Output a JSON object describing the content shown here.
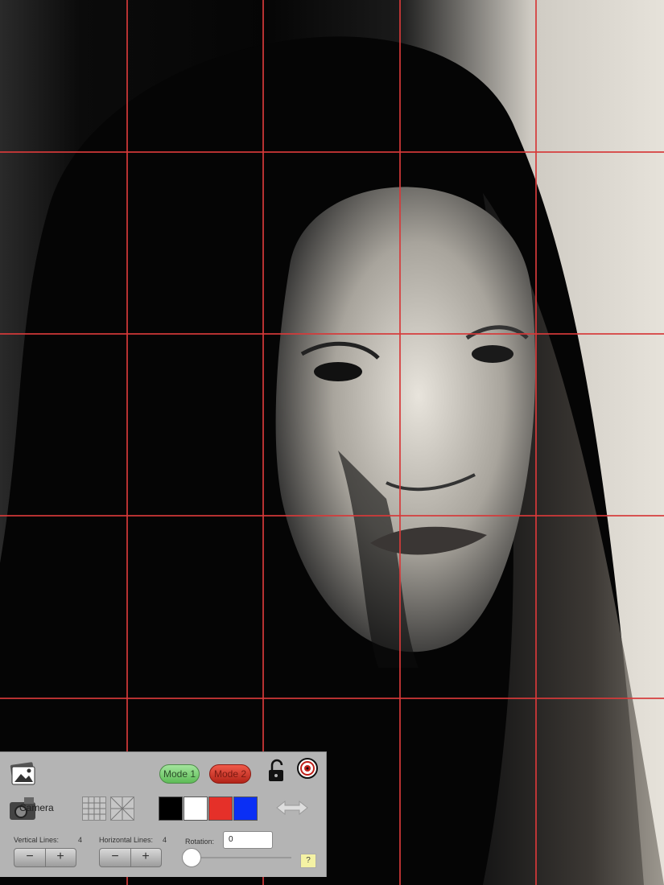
{
  "panel": {
    "mode1_label": "Mode 1",
    "mode2_label": "Mode 2",
    "camera_label": "Camera",
    "vertical_lines_label": "Vertical Lines:",
    "vertical_lines_value": "4",
    "horizontal_lines_label": "Horizontal Lines:",
    "horizontal_lines_value": "4",
    "rotation_label": "Rotation:",
    "rotation_value": "0",
    "minus_label": "−",
    "plus_label": "+",
    "help_label": "?"
  },
  "swatches": [
    "#000000",
    "#ffffff",
    "#e53029",
    "#0a2ff5"
  ],
  "grid_color": "#d63a3a"
}
